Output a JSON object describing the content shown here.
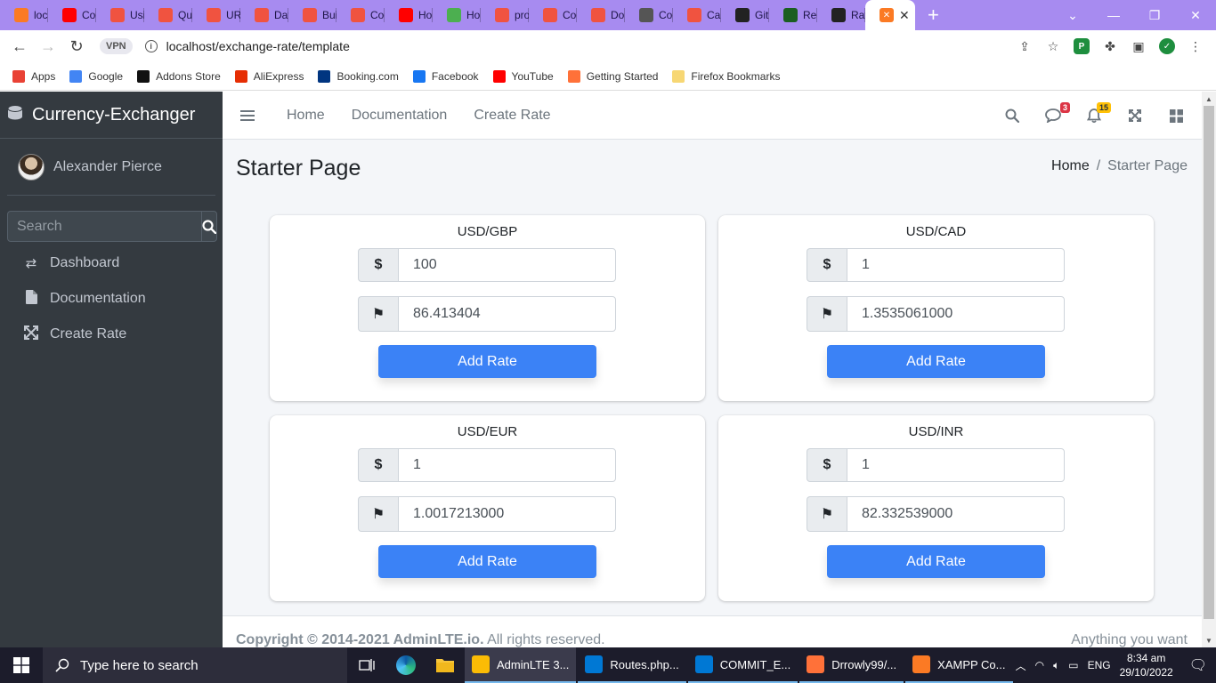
{
  "browser": {
    "tabs": [
      {
        "title": "loca",
        "icon": "xampp-icon",
        "color": "#fb7a24"
      },
      {
        "title": "Coo",
        "icon": "youtube-icon",
        "color": "#ff0000"
      },
      {
        "title": "Usi",
        "icon": "laravel-icon",
        "color": "#f05340"
      },
      {
        "title": "Qu",
        "icon": "laravel-icon",
        "color": "#f05340"
      },
      {
        "title": "URl",
        "icon": "laravel-icon",
        "color": "#f05340"
      },
      {
        "title": "Dat",
        "icon": "laravel-icon",
        "color": "#f05340"
      },
      {
        "title": "Bui",
        "icon": "laravel-icon",
        "color": "#f05340"
      },
      {
        "title": "Coo",
        "icon": "laravel-icon",
        "color": "#f05340"
      },
      {
        "title": "Ho",
        "icon": "youtube-icon",
        "color": "#ff0000"
      },
      {
        "title": "Ho",
        "icon": "page-icon",
        "color": "#4caf50"
      },
      {
        "title": "pro",
        "icon": "laravel-icon",
        "color": "#f05340"
      },
      {
        "title": "Coo",
        "icon": "laravel-icon",
        "color": "#f05340"
      },
      {
        "title": "Do",
        "icon": "laravel-icon",
        "color": "#f05340"
      },
      {
        "title": "Coo",
        "icon": "globe-icon",
        "color": "#555555"
      },
      {
        "title": "Cal",
        "icon": "laravel-icon",
        "color": "#f05340"
      },
      {
        "title": "Git",
        "icon": "github-icon",
        "color": "#222222"
      },
      {
        "title": "Rec",
        "icon": "page-icon",
        "color": "#1b5e20"
      },
      {
        "title": "Rat",
        "icon": "github-icon",
        "color": "#222222"
      }
    ],
    "active_tab_icon": "xampp-icon",
    "new_tab": "+",
    "url": "localhost/exchange-rate/template",
    "vpn_label": "VPN",
    "bookmarks": [
      {
        "label": "Apps",
        "icon": "apps-grid-icon",
        "color": "#e94235"
      },
      {
        "label": "Google",
        "icon": "google-icon",
        "color": "#4285f4"
      },
      {
        "label": "Addons Store",
        "icon": "addons-icon",
        "color": "#111111"
      },
      {
        "label": "AliExpress",
        "icon": "aliexpress-icon",
        "color": "#e62e04"
      },
      {
        "label": "Booking.com",
        "icon": "booking-icon",
        "color": "#003580"
      },
      {
        "label": "Facebook",
        "icon": "facebook-icon",
        "color": "#1877f2"
      },
      {
        "label": "YouTube",
        "icon": "youtube-icon",
        "color": "#ff0000"
      },
      {
        "label": "Getting Started",
        "icon": "firefox-icon",
        "color": "#ff7139"
      },
      {
        "label": "Firefox Bookmarks",
        "icon": "folder-icon",
        "color": "#f7d774"
      }
    ]
  },
  "sidebar": {
    "brand": "Currency-Exchanger",
    "user": "Alexander Pierce",
    "search_placeholder": "Search",
    "items": [
      {
        "label": "Dashboard",
        "icon": "exchange-arrows-icon"
      },
      {
        "label": "Documentation",
        "icon": "file-icon"
      },
      {
        "label": "Create Rate",
        "icon": "expand-arrows-icon"
      }
    ]
  },
  "topnav": {
    "links": [
      "Home",
      "Documentation",
      "Create Rate"
    ],
    "messages_badge": "3",
    "notifications_badge": "15"
  },
  "content": {
    "title": "Starter Page",
    "breadcrumb": {
      "home": "Home",
      "separator": "/",
      "current": "Starter Page"
    },
    "cards": [
      {
        "pair": "USD/GBP",
        "amount": "100",
        "result": "86.413404",
        "button": "Add Rate"
      },
      {
        "pair": "USD/CAD",
        "amount": "1",
        "result": "1.3535061000",
        "button": "Add Rate"
      },
      {
        "pair": "USD/EUR",
        "amount": "1",
        "result": "1.0017213000",
        "button": "Add Rate"
      },
      {
        "pair": "USD/INR",
        "amount": "1",
        "result": "82.332539000",
        "button": "Add Rate"
      }
    ],
    "currency_symbol": "$",
    "flag_symbol": "⚑"
  },
  "footer": {
    "copyright_strong": "Copyright © 2014-2021 AdminLTE.io.",
    "copyright_rest": " All rights reserved.",
    "right": "Anything you want"
  },
  "taskbar": {
    "search_placeholder": "Type here to search",
    "apps": [
      {
        "label": "AdminLTE 3...",
        "icon": "chrome-icon",
        "color": "#fbbc05",
        "active": true
      },
      {
        "label": "Routes.php...",
        "icon": "vscode-icon",
        "color": "#0078d4",
        "active": false
      },
      {
        "label": "COMMIT_E...",
        "icon": "vscode-icon",
        "color": "#0078d4",
        "active": false
      },
      {
        "label": "Drrowly99/...",
        "icon": "firefox-icon",
        "color": "#ff7139",
        "active": false
      },
      {
        "label": "XAMPP Co...",
        "icon": "xampp-icon",
        "color": "#fb7a24",
        "active": false
      }
    ],
    "language": "ENG",
    "time": "8:34 am",
    "date": "29/10/2022"
  }
}
